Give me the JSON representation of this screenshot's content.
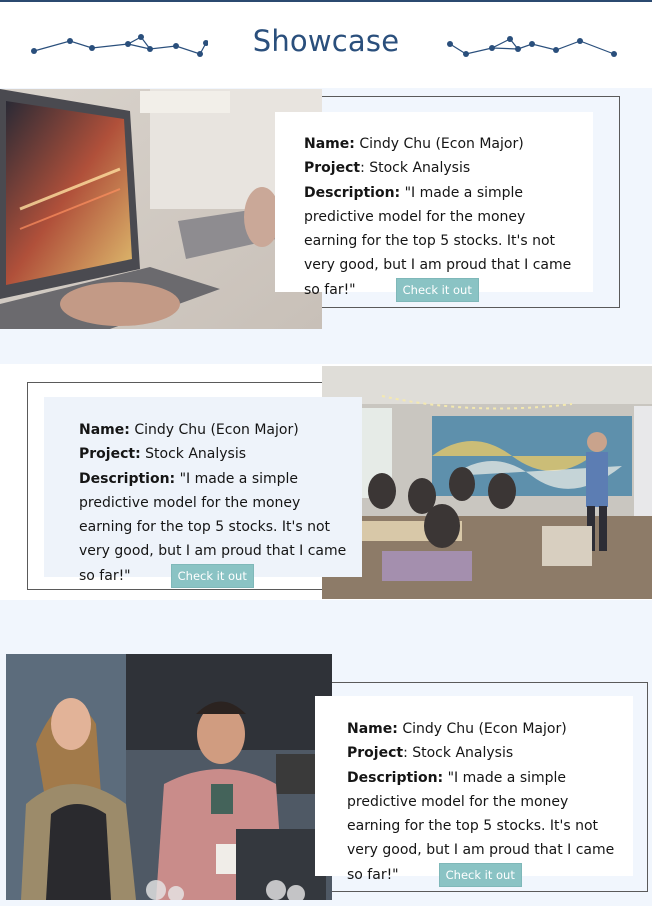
{
  "header": {
    "title": "Showcase"
  },
  "showcases": [
    {
      "name_label": "Name:",
      "name_value": "Cindy Chu (Econ Major)",
      "project_label": "Project",
      "project_value": ": Stock Analysis",
      "description_label": "Description:",
      "description_value": "\"I made a simple predictive model for the money earning for the top 5 stocks.  It's not very good, but I am proud that I came so far!\"",
      "button_label": "Check it out"
    },
    {
      "name_label": "Name:",
      "name_value": "Cindy Chu (Econ Major)",
      "project_label": "Project:",
      "project_value": "Stock Analysis",
      "description_label": "Description:",
      "description_value": "\"I made a simple predictive model for the money earning for the top 5 stocks.  It's not very good, but I am proud that I came so far!\"",
      "button_label": "Check it out"
    },
    {
      "name_label": "Name:",
      "name_value": "Cindy Chu (Econ Major)",
      "project_label": "Project",
      "project_value": ": Stock Analysis",
      "description_label": "Description:",
      "description_value": "\"I made a simple predictive model for the money earning for the top 5 stocks.  It's not very good, but I am proud that I came so far!\"",
      "button_label": "Check it out"
    }
  ],
  "images": {
    "laptop": "laptop-photo",
    "classroom": "classroom-photo",
    "people": "laughing-people-photo"
  },
  "colors": {
    "accent": "#2a4f7c",
    "button": "#8ac3c4",
    "band": "#f1f6fd"
  }
}
